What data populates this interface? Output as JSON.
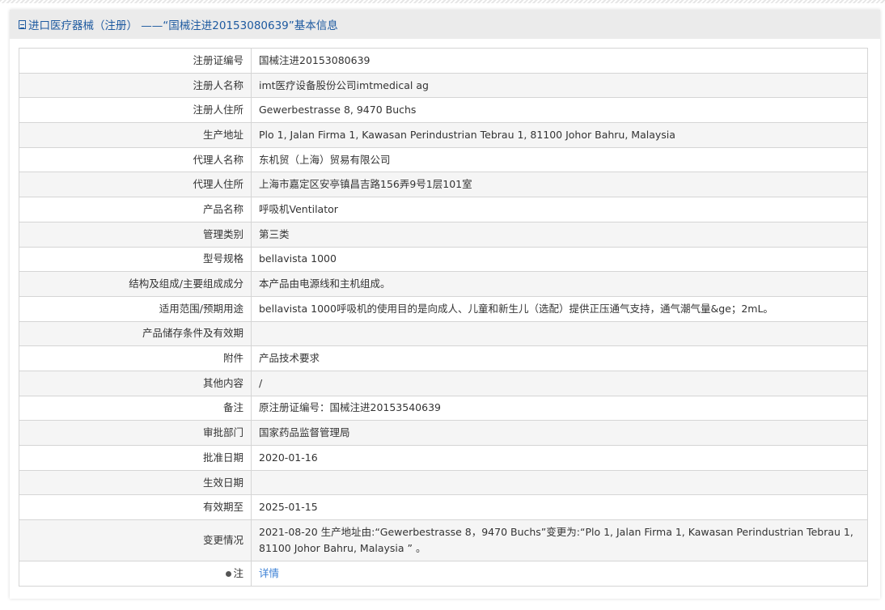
{
  "header": {
    "title": "进口医疗器械（注册） ——“国械注进20153080639”基本信息"
  },
  "rows": [
    {
      "label": "注册证编号",
      "value": "国械注进20153080639"
    },
    {
      "label": "注册人名称",
      "value": "imt医疗设备股份公司imtmedical ag"
    },
    {
      "label": "注册人住所",
      "value": "Gewerbestrasse 8, 9470 Buchs"
    },
    {
      "label": "生产地址",
      "value": "Plo 1, Jalan Firma 1, Kawasan Perindustrian Tebrau 1, 81100 Johor Bahru, Malaysia"
    },
    {
      "label": "代理人名称",
      "value": "东机贸（上海）贸易有限公司"
    },
    {
      "label": "代理人住所",
      "value": "上海市嘉定区安亭镇昌吉路156弄9号1层101室"
    },
    {
      "label": "产品名称",
      "value": "呼吸机Ventilator"
    },
    {
      "label": "管理类别",
      "value": "第三类"
    },
    {
      "label": "型号规格",
      "value": "bellavista 1000"
    },
    {
      "label": "结构及组成/主要组成成分",
      "value": "本产品由电源线和主机组成。"
    },
    {
      "label": "适用范围/预期用途",
      "value": "bellavista 1000呼吸机的使用目的是向成人、儿童和新生儿（选配）提供正压通气支持，通气潮气量&ge；2mL。"
    },
    {
      "label": "产品储存条件及有效期",
      "value": ""
    },
    {
      "label": "附件",
      "value": "产品技术要求"
    },
    {
      "label": "其他内容",
      "value": "/"
    },
    {
      "label": "备注",
      "value": "原注册证编号：国械注进20153540639"
    },
    {
      "label": "审批部门",
      "value": "国家药品监督管理局"
    },
    {
      "label": "批准日期",
      "value": "2020-01-16"
    },
    {
      "label": "生效日期",
      "value": ""
    },
    {
      "label": "有效期至",
      "value": "2025-01-15"
    },
    {
      "label": "变更情况",
      "value": "2021-08-20 生产地址由:“Gewerbestrasse 8，9470 Buchs”变更为:“Plo 1, Jalan Firma 1, Kawasan Perindustrian Tebrau 1, 81100 Johor Bahru, Malaysia ” 。"
    }
  ],
  "note": {
    "label": "注",
    "link": "详情"
  }
}
